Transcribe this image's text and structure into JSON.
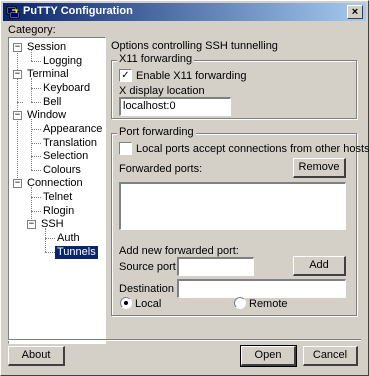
{
  "window": {
    "title": "PuTTY Configuration",
    "close_glyph": "×"
  },
  "category_label": "Category:",
  "tree": {
    "session": "Session",
    "logging": "Logging",
    "terminal": "Terminal",
    "keyboard": "Keyboard",
    "bell": "Bell",
    "window": "Window",
    "appearance": "Appearance",
    "translation": "Translation",
    "selection": "Selection",
    "colours": "Colours",
    "connection": "Connection",
    "telnet": "Telnet",
    "rlogin": "Rlogin",
    "ssh": "SSH",
    "auth": "Auth",
    "tunnels": "Tunnels"
  },
  "panel_heading": "Options controlling SSH tunnelling",
  "x11": {
    "group_label": "X11 forwarding",
    "enable_label": "Enable X11 forwarding",
    "enable_checked": true,
    "display_label": "X display location",
    "display_value": "localhost:0"
  },
  "portfwd": {
    "group_label": "Port forwarding",
    "local_ports_label": "Local ports accept connections from other hosts",
    "local_ports_checked": false,
    "forwarded_label": "Forwarded ports:",
    "remove_label": "Remove",
    "add_new_label": "Add new forwarded port:",
    "source_port_label": "Source port",
    "source_port_value": "",
    "add_label": "Add",
    "destination_label": "Destination",
    "destination_value": "",
    "local_label": "Local",
    "remote_label": "Remote",
    "selected_mode": "Local"
  },
  "buttons": {
    "about": "About",
    "open": "Open",
    "cancel": "Cancel"
  },
  "colors": {
    "face": "#d4d0c8",
    "titlebar_start": "#0a246a",
    "titlebar_end": "#a6caf0",
    "selection": "#0a246a"
  }
}
